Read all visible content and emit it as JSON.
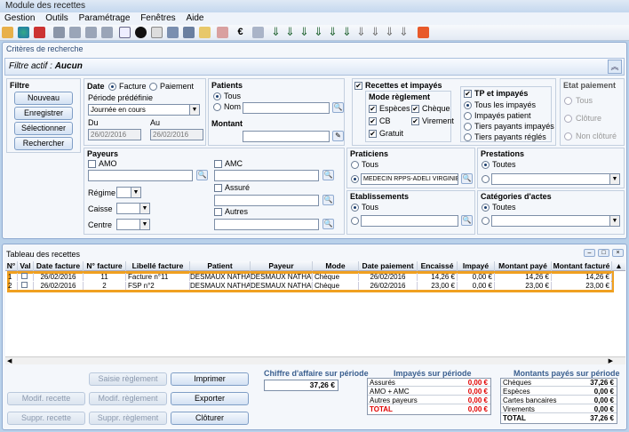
{
  "window": {
    "title": "Module des recettes"
  },
  "menu": [
    "Gestion",
    "Outils",
    "Paramétrage",
    "Fenêtres",
    "Aide"
  ],
  "criteria": {
    "title": "Critères de recherche",
    "active_filter_label": "Filtre actif :",
    "active_filter_value": "Aucun",
    "filter_group": "Filtre",
    "buttons": {
      "new": "Nouveau",
      "save_as": "Enregistrer sous",
      "select": "Sélectionner",
      "search": "Rechercher"
    },
    "date": {
      "label": "Date",
      "opt_invoice": "Facture",
      "opt_payment": "Paiement",
      "period_label": "Période prédéfinie",
      "period_value": "Journée en cours",
      "du_label": "Du",
      "du_value": "26/02/2016",
      "au_label": "Au",
      "au_value": "26/02/2016"
    },
    "patients": {
      "label": "Patients",
      "all": "Tous",
      "name": "Nom",
      "name_value": ""
    },
    "amount": {
      "label": "Montant",
      "value": ""
    },
    "receipts": {
      "label": "Recettes et impayés",
      "mode_label": "Mode règlement",
      "especes": "Espèces",
      "cheque": "Chèque",
      "cb": "CB",
      "virement": "Virement",
      "gratuit": "Gratuit"
    },
    "tp": {
      "label": "TP et impayés",
      "all": "Tous les impayés",
      "patient": "Impayés patient",
      "tiers": "Tiers payants impayés",
      "tiers_ok": "Tiers payants réglés"
    },
    "payment_state": {
      "label": "Etat paiement",
      "all": "Tous",
      "closed": "Clôture",
      "open": "Non clôturé"
    },
    "payers": {
      "label": "Payeurs",
      "amo": "AMO",
      "amc": "AMC",
      "assure": "Assuré",
      "autres": "Autres",
      "regime": "Régime",
      "caisse": "Caisse",
      "centre": "Centre"
    },
    "practitioners": {
      "label": "Praticiens",
      "all": "Tous",
      "selected": "MEDECIN RPPS-ADELI VIRGINIE"
    },
    "establishments": {
      "label": "Etablissements",
      "all": "Tous"
    },
    "services": {
      "label": "Prestations",
      "all": "Toutes"
    },
    "categories": {
      "label": "Catégories d'actes",
      "all": "Toutes"
    }
  },
  "table": {
    "title": "Tableau des recettes",
    "columns": [
      "N°",
      "Val",
      "Date facture",
      "N° facture",
      "Libellé facture",
      "Patient",
      "Payeur",
      "Mode",
      "Date paiement",
      "Encaissé",
      "Impayé",
      "Montant payé",
      "Montant facturé"
    ],
    "rows": [
      [
        "1",
        "",
        "26/02/2016",
        "11",
        "Facture n°11",
        "DESMAUX NATHAL",
        "DESMAUX NATHAL",
        "Chèque",
        "26/02/2016",
        "14,26 €",
        "0,00 €",
        "14,26 €",
        "14,26 €"
      ],
      [
        "2",
        "",
        "26/02/2016",
        "2",
        "FSP n°2",
        "DESMAUX NATHAL",
        "DESMAUX NATHAL",
        "Chèque",
        "26/02/2016",
        "23,00 €",
        "0,00 €",
        "23,00 €",
        "23,00 €"
      ]
    ]
  },
  "actions": {
    "saisie": "Saisie règlement",
    "imprimer": "Imprimer",
    "modif_recette": "Modif. recette",
    "modif_reglement": "Modif. règlement",
    "exporter": "Exporter",
    "suppr_recette": "Suppr. recette",
    "suppr_reglement": "Suppr. règlement",
    "cloturer": "Clôturer"
  },
  "turnover": {
    "title": "Chiffre d'affaire sur période",
    "value": "37,26 €"
  },
  "unpaid": {
    "title": "Impayés sur période",
    "rows": [
      [
        "Assurés",
        "0,00 €"
      ],
      [
        "AMO + AMC",
        "0,00 €"
      ],
      [
        "Autres payeurs",
        "0,00 €"
      ],
      [
        "TOTAL",
        "0,00 €"
      ]
    ]
  },
  "paid": {
    "title": "Montants payés sur période",
    "rows": [
      [
        "Chèques",
        "37,26 €"
      ],
      [
        "Espèces",
        "0,00 €"
      ],
      [
        "Cartes bancaires",
        "0,00 €"
      ],
      [
        "Virements",
        "0,00 €"
      ],
      [
        "TOTAL",
        "37,26 €"
      ]
    ]
  },
  "colors": {
    "highlight": "#f0a020",
    "accent": "#3a5f8f",
    "red": "#e00000"
  },
  "icons": [
    "users-icon",
    "chart-icon",
    "tools-icon",
    "document-icon",
    "arrow-down-icon",
    "euro-icon",
    "print-icon"
  ]
}
